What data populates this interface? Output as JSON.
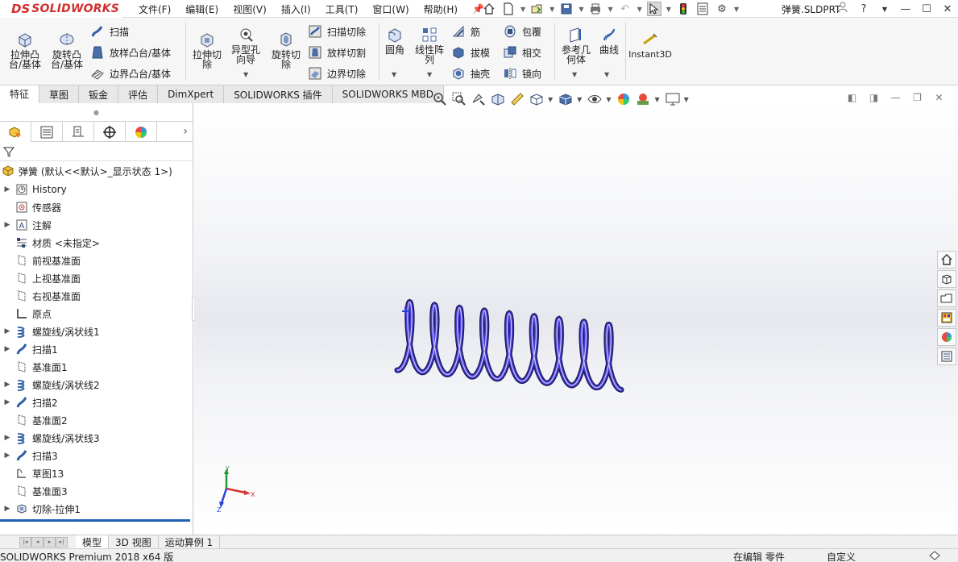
{
  "app": {
    "logo_ds": "DS",
    "logo_text": "SOLIDWORKS",
    "document_title": "弹簧.SLDPRT"
  },
  "menu": [
    "文件(F)",
    "编辑(E)",
    "视图(V)",
    "插入(I)",
    "工具(T)",
    "窗口(W)",
    "帮助(H)"
  ],
  "ribbon": {
    "extrude_boss": "拉伸凸\n台/基体",
    "revolve_boss": "旋转凸\n台/基体",
    "sweep": "扫描",
    "loft_boss": "放样凸台/基体",
    "boundary_boss": "边界凸台/基体",
    "extrude_cut": "拉伸切\n除",
    "hole_wizard": "异型孔\n向导",
    "revolve_cut": "旋转切\n除",
    "sweep_cut": "扫描切除",
    "loft_cut": "放样切割",
    "boundary_cut": "边界切除",
    "fillet": "圆角",
    "linear_pattern": "线性阵\n列",
    "rib": "筋",
    "draft": "拔模",
    "shell": "抽壳",
    "wrap": "包覆",
    "intersect": "相交",
    "mirror": "镜向",
    "reference_geometry": "参考几\n何体",
    "curves": "曲线",
    "instant3d": "Instant3D"
  },
  "ribbon_tabs": [
    "特征",
    "草图",
    "钣金",
    "评估",
    "DimXpert",
    "SOLIDWORKS 插件",
    "SOLIDWORKS MBD"
  ],
  "feature_tree": {
    "root": "弹簧  (默认<<默认>_显示状态 1>)",
    "items": [
      {
        "label": "History",
        "icon": "history-icon",
        "expandable": true
      },
      {
        "label": "传感器",
        "icon": "sensor-icon",
        "expandable": false
      },
      {
        "label": "注解",
        "icon": "annotation-icon",
        "expandable": true
      },
      {
        "label": "材质 <未指定>",
        "icon": "material-icon",
        "expandable": false
      },
      {
        "label": "前视基准面",
        "icon": "plane-icon",
        "expandable": false
      },
      {
        "label": "上视基准面",
        "icon": "plane-icon",
        "expandable": false
      },
      {
        "label": "右视基准面",
        "icon": "plane-icon",
        "expandable": false
      },
      {
        "label": "原点",
        "icon": "origin-icon",
        "expandable": false
      },
      {
        "label": "螺旋线/涡状线1",
        "icon": "helix-icon",
        "expandable": true
      },
      {
        "label": "扫描1",
        "icon": "sweep-icon",
        "expandable": true
      },
      {
        "label": "基准面1",
        "icon": "plane-icon",
        "expandable": false
      },
      {
        "label": "螺旋线/涡状线2",
        "icon": "helix-icon",
        "expandable": true
      },
      {
        "label": "扫描2",
        "icon": "sweep-icon",
        "expandable": true
      },
      {
        "label": "基准面2",
        "icon": "plane-icon",
        "expandable": false
      },
      {
        "label": "螺旋线/涡状线3",
        "icon": "helix-icon",
        "expandable": true
      },
      {
        "label": "扫描3",
        "icon": "sweep-icon",
        "expandable": true
      },
      {
        "label": "草图13",
        "icon": "sketch-icon",
        "expandable": false
      },
      {
        "label": "基准面3",
        "icon": "plane-icon",
        "expandable": false
      },
      {
        "label": "切除-拉伸1",
        "icon": "extrude-cut-icon",
        "expandable": true
      }
    ]
  },
  "triad": {
    "x": "X",
    "y": "Y",
    "z": "Z"
  },
  "bottom_tabs": [
    "模型",
    "3D 视图",
    "运动算例 1"
  ],
  "status": {
    "product": "SOLIDWORKS Premium 2018 x64 版",
    "mode": "在编辑 零件",
    "units": "自定义"
  },
  "colors": {
    "brand": "#d32f2f",
    "spring": "#4a3fd6",
    "accent": "#1e5fb4"
  }
}
